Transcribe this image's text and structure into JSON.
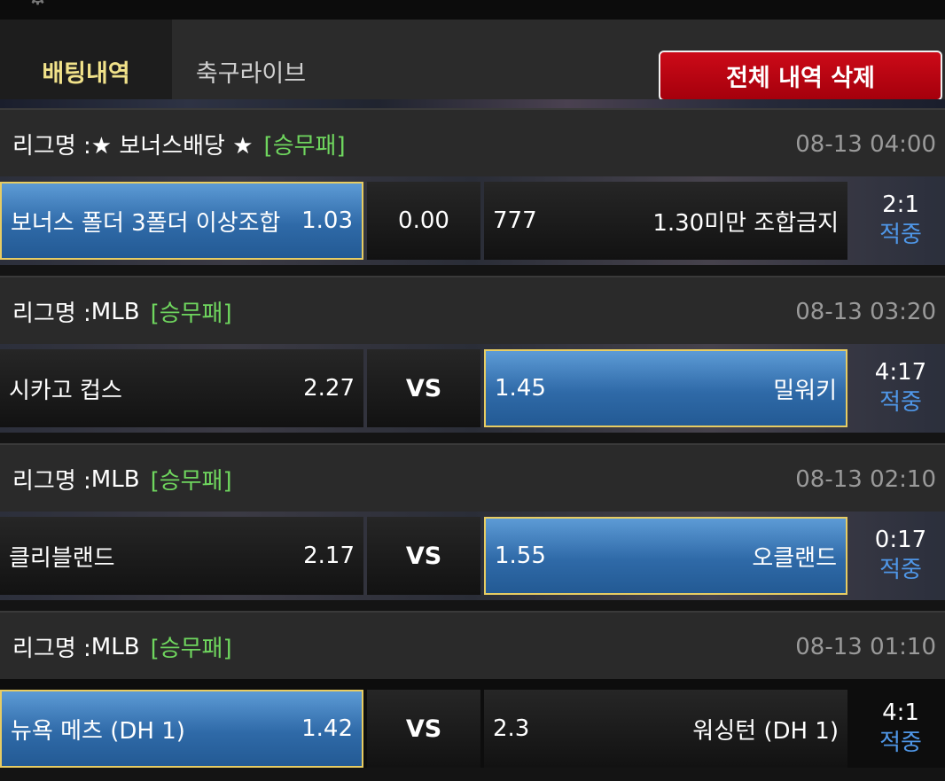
{
  "header": {
    "tabs": [
      {
        "label": "배팅내역"
      },
      {
        "label": "축구라이브"
      }
    ],
    "delete_all_label": "전체 내역 삭제"
  },
  "bets": [
    {
      "league_prefix": "리그명 : ",
      "league": "★ 보너스배당 ★",
      "market": "[승무패]",
      "time": "08-13 04:00",
      "home": {
        "name": "보너스 폴더 3폴더 이상조합",
        "odds": "1.03"
      },
      "middle": "0.00",
      "away": {
        "odds": "777",
        "name": "1.30미만 조합금지"
      },
      "score": "2:1",
      "status": "적중"
    },
    {
      "league_prefix": "리그명 : ",
      "league": "MLB",
      "market": "[승무패]",
      "time": "08-13 03:20",
      "home": {
        "name": "시카고 컵스",
        "odds": "2.27"
      },
      "middle": "VS",
      "away": {
        "odds": "1.45",
        "name": "밀워키"
      },
      "score": "4:17",
      "status": "적중"
    },
    {
      "league_prefix": "리그명 : ",
      "league": "MLB",
      "market": "[승무패]",
      "time": "08-13 02:10",
      "home": {
        "name": "클리블랜드",
        "odds": "2.17"
      },
      "middle": "VS",
      "away": {
        "odds": "1.55",
        "name": "오클랜드"
      },
      "score": "0:17",
      "status": "적중"
    },
    {
      "league_prefix": "리그명 : ",
      "league": "MLB",
      "market": "[승무패]",
      "time": "08-13 01:10",
      "home": {
        "name": "뉴욕 메츠 (DH 1)",
        "odds": "1.42"
      },
      "middle": "VS",
      "away": {
        "odds": "2.3",
        "name": "워싱턴 (DH 1)"
      },
      "score": "4:1",
      "status": "적중"
    }
  ],
  "colors": {
    "active_tab_text": "#f1e28a",
    "market_tag": "#6fd65e",
    "status_text": "#4f97e8",
    "delete_button": "#c00012",
    "selected_cell": "#3a78b8",
    "selected_border": "#e7cc63"
  },
  "icons": {
    "top_left": "gear-icon"
  }
}
